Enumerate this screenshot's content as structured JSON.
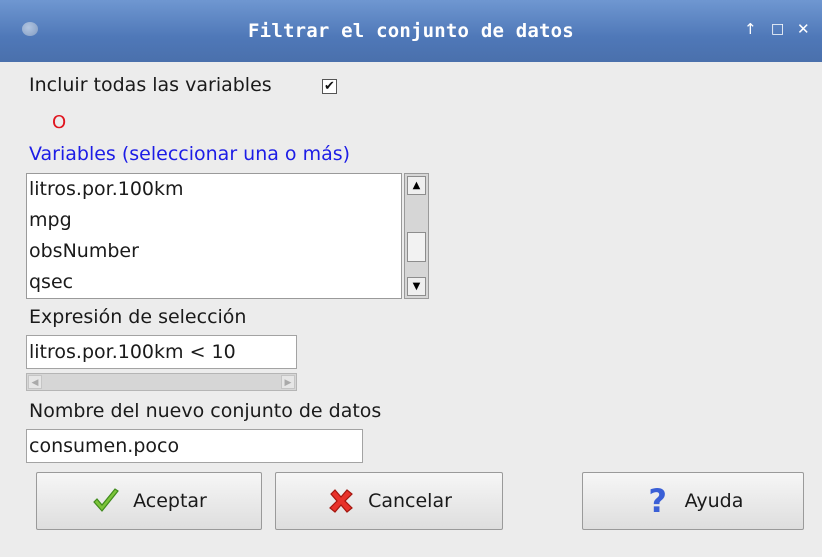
{
  "window": {
    "title": "Filtrar el conjunto de datos",
    "controls": {
      "raise": "↑",
      "maximize": "□",
      "close": "✕"
    }
  },
  "include_all": {
    "label": "Incluir todas las variables",
    "checked": true,
    "check_glyph": "✔"
  },
  "or_label": "O",
  "variables": {
    "label": "Variables (seleccionar una o más)",
    "items": [
      "litros.por.100km",
      "mpg",
      "obsNumber",
      "qsec"
    ]
  },
  "selection": {
    "label": "Expresión de selección",
    "value": "litros.por.100km < 10"
  },
  "new_dataset": {
    "label": "Nombre del nuevo conjunto de datos",
    "value": "consumen.poco"
  },
  "buttons": {
    "accept": "Aceptar",
    "cancel": "Cancelar",
    "help": "Ayuda"
  },
  "colors": {
    "titlebar": "#4f78b8",
    "variables_label": "#1c1ce6",
    "or_label": "#e0141e"
  },
  "icons": {
    "accept": "checkmark-icon",
    "cancel": "red-x-icon",
    "help": "question-mark-icon"
  }
}
